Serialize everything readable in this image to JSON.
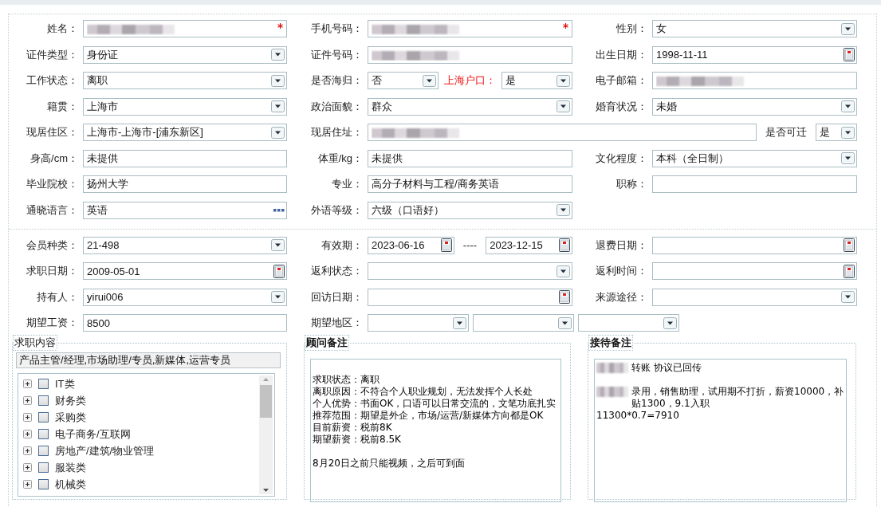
{
  "sections": [
    {
      "rows": [
        [
          {
            "label": "姓名：",
            "controls": [
              {
                "kind": "text",
                "blurred": true,
                "required": true
              }
            ]
          },
          {
            "label": "手机号码：",
            "controls": [
              {
                "kind": "text",
                "blurred": true,
                "required": true
              }
            ]
          },
          {
            "label": "性别：",
            "controls": [
              {
                "kind": "select",
                "value": "女"
              }
            ]
          }
        ],
        [
          {
            "label": "证件类型：",
            "controls": [
              {
                "kind": "select",
                "value": "身份证"
              }
            ]
          },
          {
            "label": "证件号码：",
            "controls": [
              {
                "kind": "text",
                "blurred": true
              }
            ]
          },
          {
            "label": "出生日期：",
            "controls": [
              {
                "kind": "date",
                "value": "1998-11-11"
              }
            ]
          }
        ],
        [
          {
            "label": "工作状态：",
            "controls": [
              {
                "kind": "select",
                "value": "离职"
              }
            ]
          },
          {
            "label": "是否海归：",
            "controls": [
              {
                "kind": "select",
                "value": "否"
              },
              {
                "kind": "label",
                "text": "上海户口：",
                "highlight": true
              },
              {
                "kind": "select",
                "value": "是"
              }
            ]
          },
          {
            "label": "电子邮箱：",
            "controls": [
              {
                "kind": "text",
                "blurred": true
              }
            ]
          }
        ],
        [
          {
            "label": "籍贯：",
            "controls": [
              {
                "kind": "select",
                "value": "上海市"
              }
            ]
          },
          {
            "label": "政治面貌：",
            "controls": [
              {
                "kind": "select",
                "value": "群众"
              }
            ]
          },
          {
            "label": "婚育状况：",
            "controls": [
              {
                "kind": "select",
                "value": "未婚"
              }
            ]
          }
        ],
        [
          {
            "label": "现居住区：",
            "controls": [
              {
                "kind": "select",
                "value": "上海市-上海市-[浦东新区]"
              }
            ]
          },
          {
            "label": "现居住址：",
            "wide": true,
            "controls": [
              {
                "kind": "text",
                "blurred": true
              },
              {
                "kind": "label",
                "text": "是否可迁",
                "highlight": false
              },
              {
                "kind": "select",
                "value": "是"
              }
            ]
          }
        ],
        [
          {
            "label": "身高/cm：",
            "controls": [
              {
                "kind": "text",
                "value": "未提供"
              }
            ]
          },
          {
            "label": "体重/kg：",
            "controls": [
              {
                "kind": "text",
                "value": "未提供"
              }
            ]
          },
          {
            "label": "文化程度：",
            "controls": [
              {
                "kind": "select",
                "value": "本科（全日制）"
              }
            ]
          }
        ],
        [
          {
            "label": "毕业院校：",
            "controls": [
              {
                "kind": "text",
                "value": "扬州大学"
              }
            ]
          },
          {
            "label": "专业：",
            "controls": [
              {
                "kind": "text",
                "value": "高分子材料与工程/商务英语"
              }
            ]
          },
          {
            "label": "职称：",
            "controls": [
              {
                "kind": "text"
              }
            ]
          }
        ],
        [
          {
            "label": "通晓语言：",
            "controls": [
              {
                "kind": "more",
                "value": "英语"
              }
            ]
          },
          {
            "label": "外语等级：",
            "controls": [
              {
                "kind": "select",
                "value": "六级（口语好）"
              }
            ]
          }
        ]
      ]
    },
    {
      "rows": [
        [
          {
            "label": "会员种类：",
            "controls": [
              {
                "kind": "select",
                "value": "21-498"
              }
            ]
          },
          {
            "label": "有效期：",
            "controls": [
              {
                "kind": "date",
                "value": "2023-06-16"
              },
              {
                "kind": "label",
                "text": "----",
                "highlight": false
              },
              {
                "kind": "date",
                "value": "2023-12-15"
              }
            ]
          },
          {
            "label": "退费日期：",
            "controls": [
              {
                "kind": "date"
              }
            ]
          }
        ],
        [
          {
            "label": "求职日期：",
            "controls": [
              {
                "kind": "date",
                "value": "2009-05-01"
              }
            ]
          },
          {
            "label": "返利状态：",
            "controls": [
              {
                "kind": "select"
              }
            ]
          },
          {
            "label": "返利时间：",
            "controls": [
              {
                "kind": "date"
              }
            ]
          }
        ],
        [
          {
            "label": "持有人：",
            "controls": [
              {
                "kind": "select",
                "value": "yirui006"
              }
            ]
          },
          {
            "label": "回访日期：",
            "controls": [
              {
                "kind": "date"
              }
            ]
          },
          {
            "label": "来源途径：",
            "controls": [
              {
                "kind": "select"
              }
            ]
          }
        ],
        [
          {
            "label": "期望工资：",
            "controls": [
              {
                "kind": "text",
                "value": "8500"
              }
            ]
          },
          {
            "label": "期望地区：",
            "wide": true,
            "controls": [
              {
                "kind": "select"
              },
              {
                "kind": "select"
              },
              {
                "kind": "select"
              }
            ]
          }
        ]
      ]
    }
  ],
  "panels": [
    {
      "kind": "tree",
      "title": "求职内容",
      "selection": "产品主管/经理,市场助理/专员,新媒体,运营专员",
      "items": [
        {
          "label": "IT类",
          "checked": false,
          "expanded": false
        },
        {
          "label": "财务类",
          "checked": false,
          "expanded": false
        },
        {
          "label": "采购类",
          "checked": false,
          "expanded": false
        },
        {
          "label": "电子商务/互联网",
          "checked": false,
          "expanded": false
        },
        {
          "label": "房地产/建筑/物业管理",
          "checked": false,
          "expanded": false
        },
        {
          "label": "服装类",
          "checked": false,
          "expanded": false
        },
        {
          "label": "机械类",
          "checked": false,
          "expanded": false
        }
      ]
    },
    {
      "kind": "note",
      "title": "顾问备注",
      "leading_blank": true,
      "paragraphs": [
        {
          "lines": [
            {
              "text": "求职状态：离职"
            },
            {
              "text": "离职原因：不符合个人职业规划，无法发挥个人长处"
            },
            {
              "text": "个人优势：书面OK，口语可以日常交流的，文笔功底扎实"
            },
            {
              "text": "推荐范围：期望是外企，市场/运营/新媒体方向都是OK"
            },
            {
              "text": "目前薪资：税前8K"
            },
            {
              "text": "期望薪资：税前8.5K"
            }
          ]
        },
        {
          "lines": [
            {
              "text": "8月20日之前只能视频，之后可到面"
            }
          ]
        }
      ]
    },
    {
      "kind": "note",
      "title": "接待备注",
      "leading_blank": false,
      "paragraphs": [
        {
          "lines": [
            {
              "text": "转账 协议已回传",
              "blurred_prefix": true
            }
          ]
        },
        {
          "lines": [
            {
              "text": "录用，销售助理，试用期不打折，薪资10000，补贴1300，9.1入职",
              "blurred_prefix": true
            },
            {
              "text": "11300*0.7=7910"
            }
          ]
        }
      ]
    }
  ]
}
